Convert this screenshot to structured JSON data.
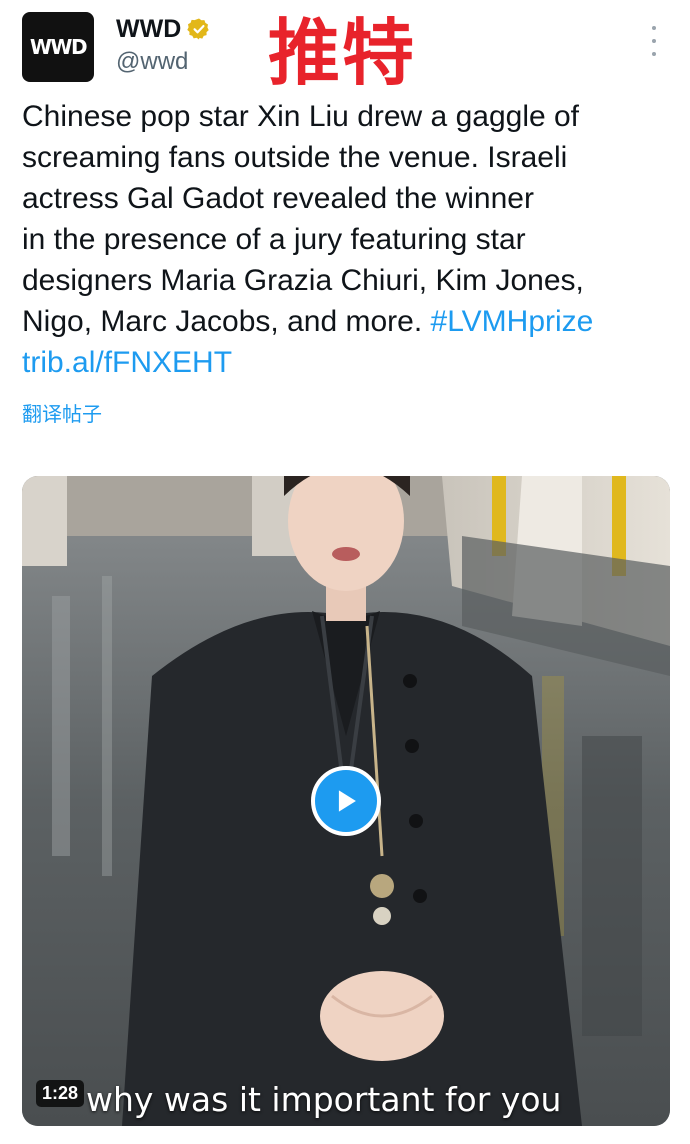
{
  "header": {
    "avatar_text": "WWD",
    "display_name": "WWD",
    "handle": "@wwd",
    "overlay_title": "推特"
  },
  "tweet": {
    "lines": [
      "Chinese pop star Xin Liu drew a gaggle of",
      "screaming fans outside the venue. Israeli",
      "actress Gal Gadot revealed the winner",
      "in the presence of a jury featuring star",
      "designers Maria Grazia Chiuri, Kim Jones,",
      "Nigo, Marc Jacobs, and more. "
    ],
    "hashtag": "#LVMHprize",
    "link": "trib.al/fFNXEHT",
    "translate_label": "翻译帖子"
  },
  "media": {
    "duration": "1:28",
    "caption": "why was it important for you"
  },
  "colors": {
    "accent": "#1d9bf0",
    "overlay_red": "#e8232b",
    "verified_gold": "#e2b719"
  }
}
